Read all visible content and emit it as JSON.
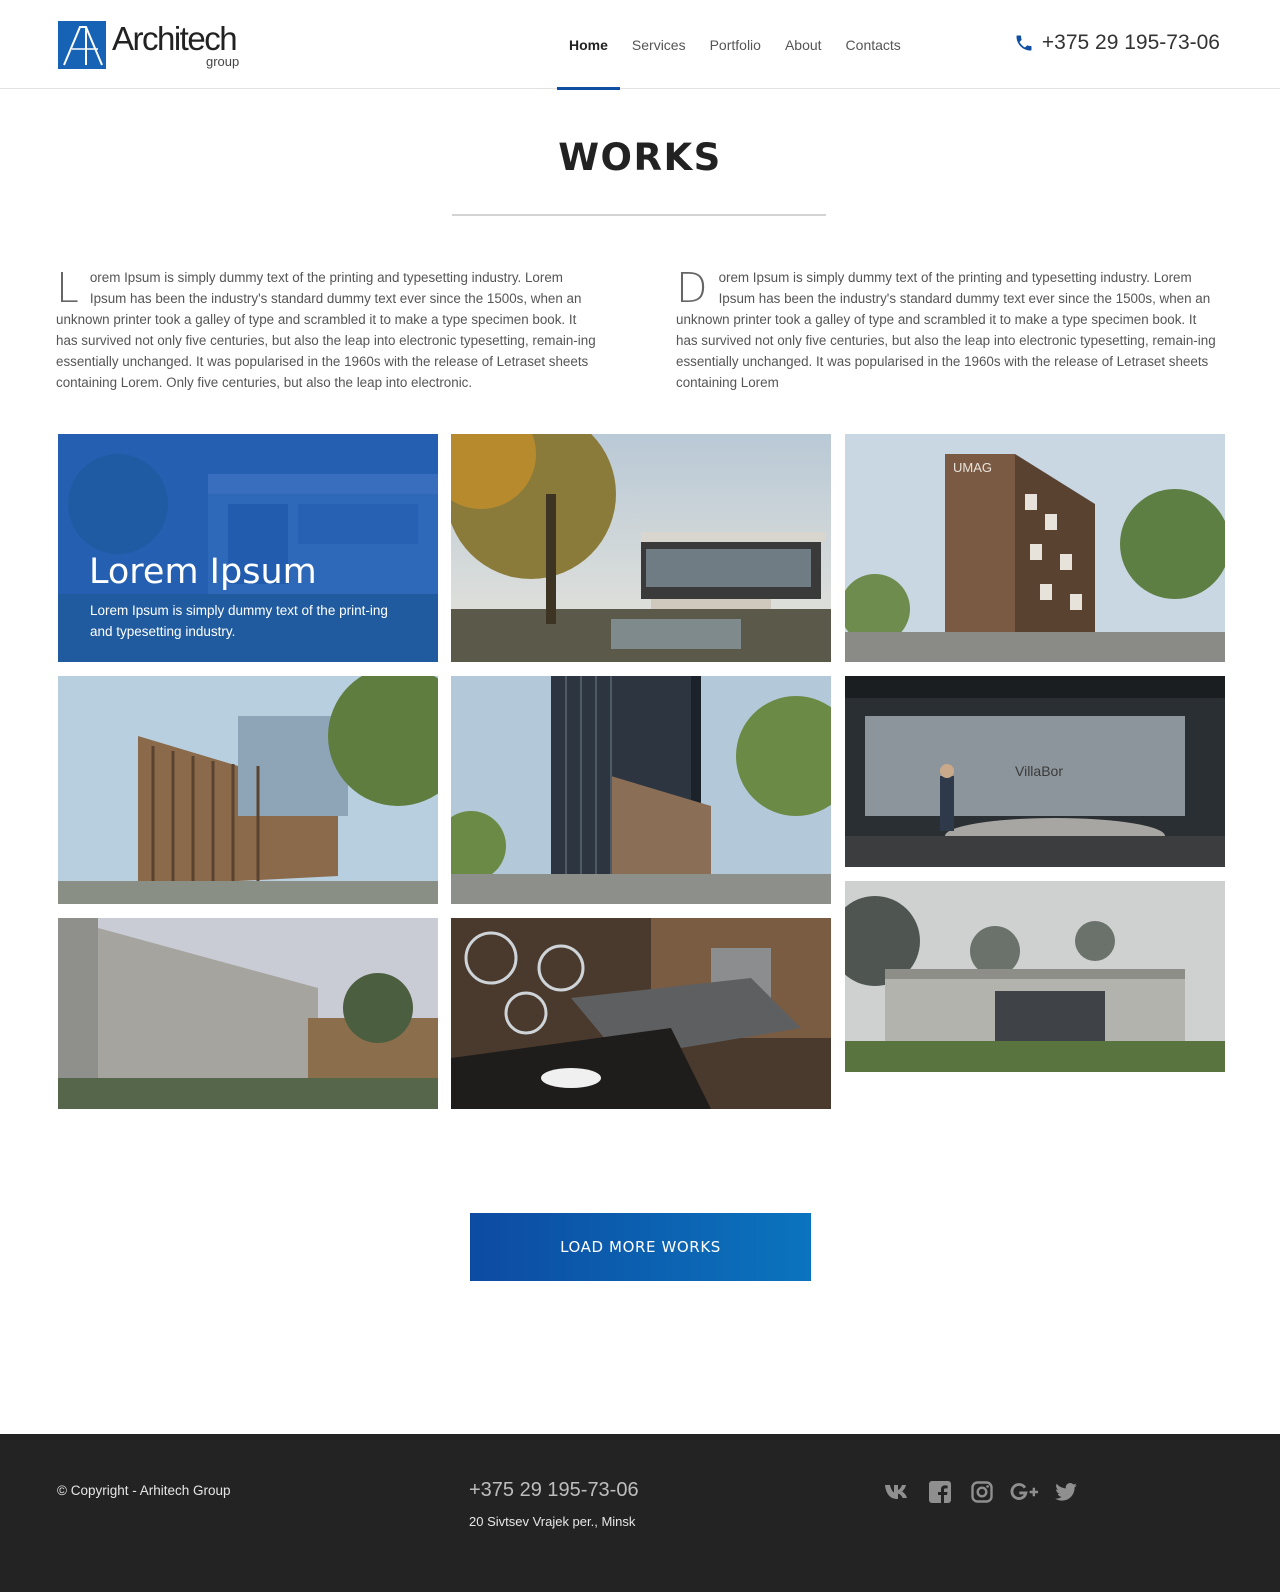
{
  "header": {
    "logo": {
      "name": "Architech",
      "sub": "group"
    },
    "nav": [
      {
        "label": "Home",
        "active": true
      },
      {
        "label": "Services",
        "active": false
      },
      {
        "label": "Portfolio",
        "active": false
      },
      {
        "label": "About",
        "active": false
      },
      {
        "label": "Contacts",
        "active": false
      }
    ],
    "phone": "+375 29 195-73-06",
    "phone_icon": "phone-icon"
  },
  "works": {
    "title": "WORKS",
    "intro_left": {
      "dropcap": "L",
      "text": "orem Ipsum is simply dummy text of the printing and typesetting industry. Lorem Ipsum has been the industry's standard dummy text ever since the 1500s, when an unknown printer took a galley of type and scrambled it to make a type specimen book. It has survived not only five centuries, but also the leap into electronic typesetting, remain-ing essentially unchanged. It was popularised in the 1960s with the release of Letraset sheets containing Lorem. Only five centuries, but also the leap into electronic."
    },
    "intro_right": {
      "dropcap": "D",
      "text": "orem Ipsum is simply dummy text of the printing and typesetting industry. Lorem Ipsum has been the industry's standard dummy text ever since the 1500s, when an unknown printer took a galley of type and scrambled it to make a type specimen book. It has survived not only five centuries, but also the leap into electronic typesetting, remain-ing essentially unchanged. It was popularised in the 1960s with the release of Letraset sheets containing Lorem"
    },
    "featured": {
      "title": "Lorem Ipsum",
      "text": "Lorem Ipsum is simply dummy text of the print-ing and typesetting industry."
    },
    "tile_signs": {
      "umag": "UMAG",
      "villabor": "VillaBor"
    },
    "load_more": "LOAD MORE WORKS"
  },
  "footer": {
    "copyright": "© Copyright - Arhitech Group",
    "phone": "+375 29 195-73-06",
    "address": "20 Sivtsev Vrajek per., Minsk",
    "socials": [
      "vk-icon",
      "facebook-icon",
      "instagram-icon",
      "google-plus-icon",
      "twitter-icon"
    ]
  },
  "colors": {
    "accent": "#0e4fa2",
    "footer_bg": "#232323"
  }
}
